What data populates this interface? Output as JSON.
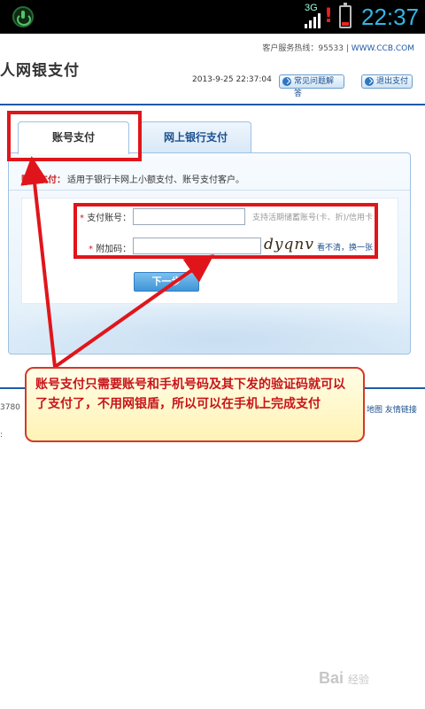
{
  "status_bar": {
    "network_label": "3G",
    "time": "22:37",
    "battery_level": 0.2,
    "icons": [
      "power-icon",
      "signal-icon",
      "alert-icon",
      "battery-icon"
    ]
  },
  "header": {
    "hotline_prefix": "客户服务热线：95533 | ",
    "hotline_link": "WWW.CCB.COM",
    "title": "人网银支付",
    "datetime": "2013-9-25 22:37:04",
    "faq_button": "常见问题解答",
    "exit_button": "退出支付"
  },
  "tabs": [
    {
      "label": "账号支付",
      "active": true
    },
    {
      "label": "网上银行支付",
      "active": false
    }
  ],
  "panel": {
    "desc_title": "账号支付：",
    "desc_text": "适用于银行卡网上小额支付、账号支付客户。",
    "account_label": "支付账号：",
    "account_value": "",
    "account_hint": "支持活期储蓄账号(卡、折)/信用卡",
    "code_label": "附加码：",
    "code_value": "",
    "captcha_text": "dyqnv",
    "refresh_link": "看不清，换一张",
    "next_button": "下一步"
  },
  "footer": {
    "left_text": "3780",
    "left_text2": ":",
    "links": "地图  友情链接"
  },
  "annotation": {
    "callout_text": "账号支付只需要账号和手机号码及其下发的验证码就可以了支付了，不用网银盾，所以可以在手机上完成支付"
  },
  "watermark": {
    "main": "Bai",
    "sub": "经验"
  },
  "colors": {
    "accent": "#1f5aa8",
    "annotation_red": "#e0151b",
    "clock_blue": "#33b5e5"
  }
}
